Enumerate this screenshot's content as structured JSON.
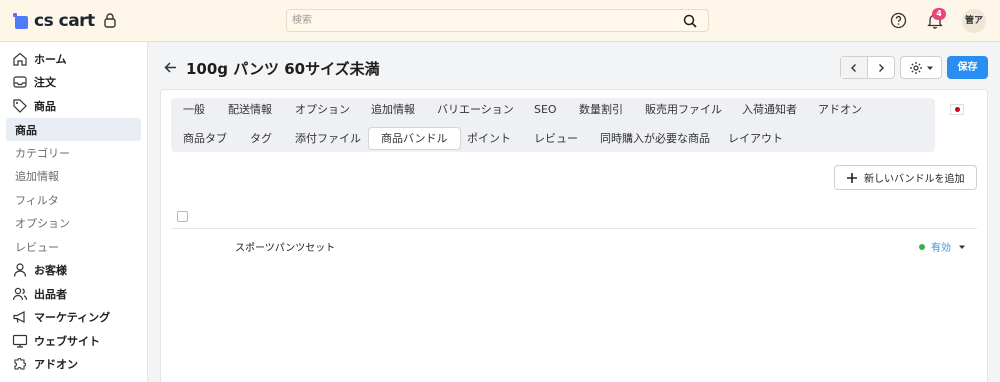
{
  "app": {
    "logo_text": "cs cart",
    "brand_color": "#4f7bf7"
  },
  "search": {
    "placeholder": "検索"
  },
  "notifications": {
    "count": "4"
  },
  "user": {
    "avatar_text": "管ア"
  },
  "sidebar": {
    "items": [
      {
        "label": "ホーム",
        "icon": "home-icon",
        "level": "main"
      },
      {
        "label": "注文",
        "icon": "inbox-icon",
        "level": "main"
      },
      {
        "label": "商品",
        "icon": "tag-icon",
        "level": "main"
      },
      {
        "label": "商品",
        "icon": "",
        "level": "active"
      },
      {
        "label": "カテゴリー",
        "icon": "",
        "level": "sub"
      },
      {
        "label": "追加情報",
        "icon": "",
        "level": "sub"
      },
      {
        "label": "フィルタ",
        "icon": "",
        "level": "sub"
      },
      {
        "label": "オプション",
        "icon": "",
        "level": "sub"
      },
      {
        "label": "レビュー",
        "icon": "",
        "level": "sub"
      },
      {
        "label": "お客様",
        "icon": "user-icon",
        "level": "main"
      },
      {
        "label": "出品者",
        "icon": "users-icon",
        "level": "main"
      },
      {
        "label": "マーケティング",
        "icon": "megaphone-icon",
        "level": "main"
      },
      {
        "label": "ウェブサイト",
        "icon": "monitor-icon",
        "level": "main"
      },
      {
        "label": "アドオン",
        "icon": "puzzle-icon",
        "level": "main"
      }
    ]
  },
  "page": {
    "title": "100g パンツ 60サイズ未満",
    "save_label": "保存"
  },
  "tabs": {
    "row1": [
      "一般",
      "配送情報",
      "オプション",
      "追加情報",
      "バリエーション",
      "SEO",
      "数量割引",
      "販売用ファイル",
      "入荷通知者",
      "アドオン"
    ],
    "row2": [
      "商品タブ",
      "タグ",
      "添付ファイル",
      "商品バンドル",
      "ポイント",
      "レビュー",
      "同時購入が必要な商品",
      "レイアウト"
    ],
    "active": "商品バンドル"
  },
  "bundles": {
    "add_label": "新しいバンドルを追加",
    "rows": [
      {
        "name": "スポーツパンツセット",
        "status": "有効",
        "status_color": "#38b24a"
      }
    ]
  },
  "colors": {
    "primary": "#2a8ef0",
    "topbar": "#fdf6e9",
    "badge": "#e9457c"
  }
}
